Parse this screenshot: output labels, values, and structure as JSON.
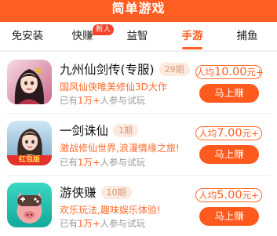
{
  "header": {
    "title": "简单游戏"
  },
  "tabs": [
    {
      "label": "免安装"
    },
    {
      "label": "快赚",
      "badge": "新人"
    },
    {
      "label": "益智"
    },
    {
      "label": "手游",
      "active": true
    },
    {
      "label": "捕鱼"
    }
  ],
  "games": [
    {
      "name": "九州仙剑传(专服)",
      "issue": "29期",
      "desc": "国风仙侠唯美修仙3D大作",
      "joined_prefix": "已有",
      "joined_count": "1万+",
      "joined_suffix": "人参与试玩",
      "reward_prefix": "人均",
      "reward_amount": "10.00",
      "reward_suffix": "元+",
      "button": "马上赚",
      "icon": "fairy-game-icon"
    },
    {
      "name": "一剑诛仙",
      "issue": "1期",
      "desc": "激战修仙世界,浪漫情缘之旅!",
      "joined_prefix": "已有",
      "joined_count": "1万+",
      "joined_suffix": "人参与试玩",
      "reward_prefix": "人均",
      "reward_amount": "7.00",
      "reward_suffix": "元+",
      "button": "马上赚",
      "icon": "swordsman-game-icon",
      "icon_tag": "红包版"
    },
    {
      "name": "游侠赚",
      "issue": "10期",
      "desc": "欢乐玩法,趣味娱乐体验!",
      "joined_prefix": "已有",
      "joined_count": "1万+",
      "joined_suffix": "人参与试玩",
      "reward_prefix": "人均",
      "reward_amount": "5.00",
      "reward_suffix": "元+",
      "button": "马上赚",
      "icon": "gamepad-pig-icon"
    }
  ]
}
